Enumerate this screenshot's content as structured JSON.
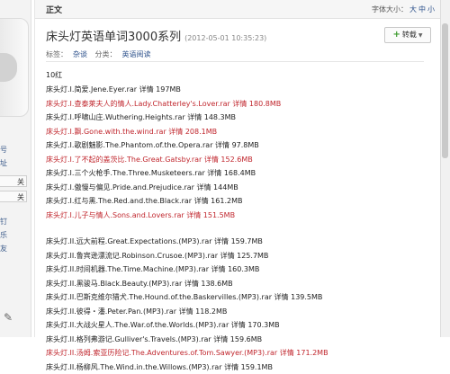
{
  "sidebar": {
    "links": [
      "号",
      "址",
      "钉",
      "乐",
      "友"
    ],
    "buttons": [
      "关",
      "关"
    ],
    "icon": "edit-icon"
  },
  "header": {
    "tab": "正文",
    "font_size_label": "字体大小：",
    "font_sizes": [
      "大",
      "中",
      "小"
    ]
  },
  "article": {
    "title": "床头灯英语单词3000系列",
    "date": "(2012-05-01 10:35:23)",
    "share_label": "转载",
    "tags_label": "标签：",
    "tags": "杂谈",
    "category_label": "分类：",
    "category": "英语阅读"
  },
  "group1": {
    "title": "10红",
    "items": [
      {
        "text": "床头灯.I.简爱.Jene.Eyer.rar 详情  197MB",
        "red": false
      },
      {
        "text": "床头灯.I.查泰莱夫人的情人.Lady.Chatterley's.Lover.rar 详情  180.8MB",
        "red": true
      },
      {
        "text": "床头灯.I.呼啸山庄.Wuthering.Heights.rar 详情  148.3MB",
        "red": false
      },
      {
        "text": "床头灯.I.飘.Gone.with.the.wind.rar 详情  208.1MB",
        "red": true
      },
      {
        "text": "床头灯.I.歌剧魅影.The.Phantom.of.the.Opera.rar 详情  97.8MB",
        "red": false
      },
      {
        "text": "床头灯.I.了不起的盖茨比.The.Great.Gatsby.rar 详情  152.6MB",
        "red": true
      },
      {
        "text": "床头灯.I.三个火枪手.The.Three.Musketeers.rar 详情  168.4MB",
        "red": false
      },
      {
        "text": "床头灯.I.傲慢与偏见.Pride.and.Prejudice.rar 详情  144MB",
        "red": false
      },
      {
        "text": "床头灯.I.红与黑.The.Red.and.the.Black.rar 详情  161.2MB",
        "red": false
      },
      {
        "text": "床头灯.I.儿子与情人.Sons.and.Lovers.rar 详情  151.5MB",
        "red": true
      }
    ]
  },
  "group2": {
    "items": [
      {
        "text": "床头灯.II.远大前程.Great.Expectations.(MP3).rar 详情  159.7MB",
        "red": false
      },
      {
        "text": "床头灯.II.鲁宾逊漂流记.Robinson.Crusoe.(MP3).rar 详情  125.7MB",
        "red": false
      },
      {
        "text": "床头灯.II.时间机器.The.Time.Machine.(MP3).rar 详情  160.3MB",
        "red": false
      },
      {
        "text": "床头灯.II.黑骏马.Black.Beauty.(MP3).rar 详情  138.6MB",
        "red": false
      },
      {
        "text": "床头灯.II.巴斯克维尔猎犬.The.Hound.of.the.Baskervilles.(MP3).rar 详情  139.5MB",
        "red": false
      },
      {
        "text": "床头灯.II.彼得・潘.Peter.Pan.(MP3).rar 详情  118.2MB",
        "red": false
      },
      {
        "text": "床头灯.II.大战火星人.The.War.of.the.Worlds.(MP3).rar 详情  170.3MB",
        "red": false
      },
      {
        "text": "床头灯.II.格列弗游记.Gulliver's.Travels.(MP3).rar 详情  159.6MB",
        "red": false
      },
      {
        "text": "床头灯.II.汤姆.索亚历险记.The.Adventures.of.Tom.Sawyer.(MP3).rar 详情  171.2MB",
        "red": true
      },
      {
        "text": "床头灯.II.杨柳风.The.Wind.in.the.Willows.(MP3).rar 详情  159.1MB",
        "red": false
      }
    ]
  },
  "colors": {
    "red_text": "#c0262d",
    "link": "#2a4f8a"
  }
}
